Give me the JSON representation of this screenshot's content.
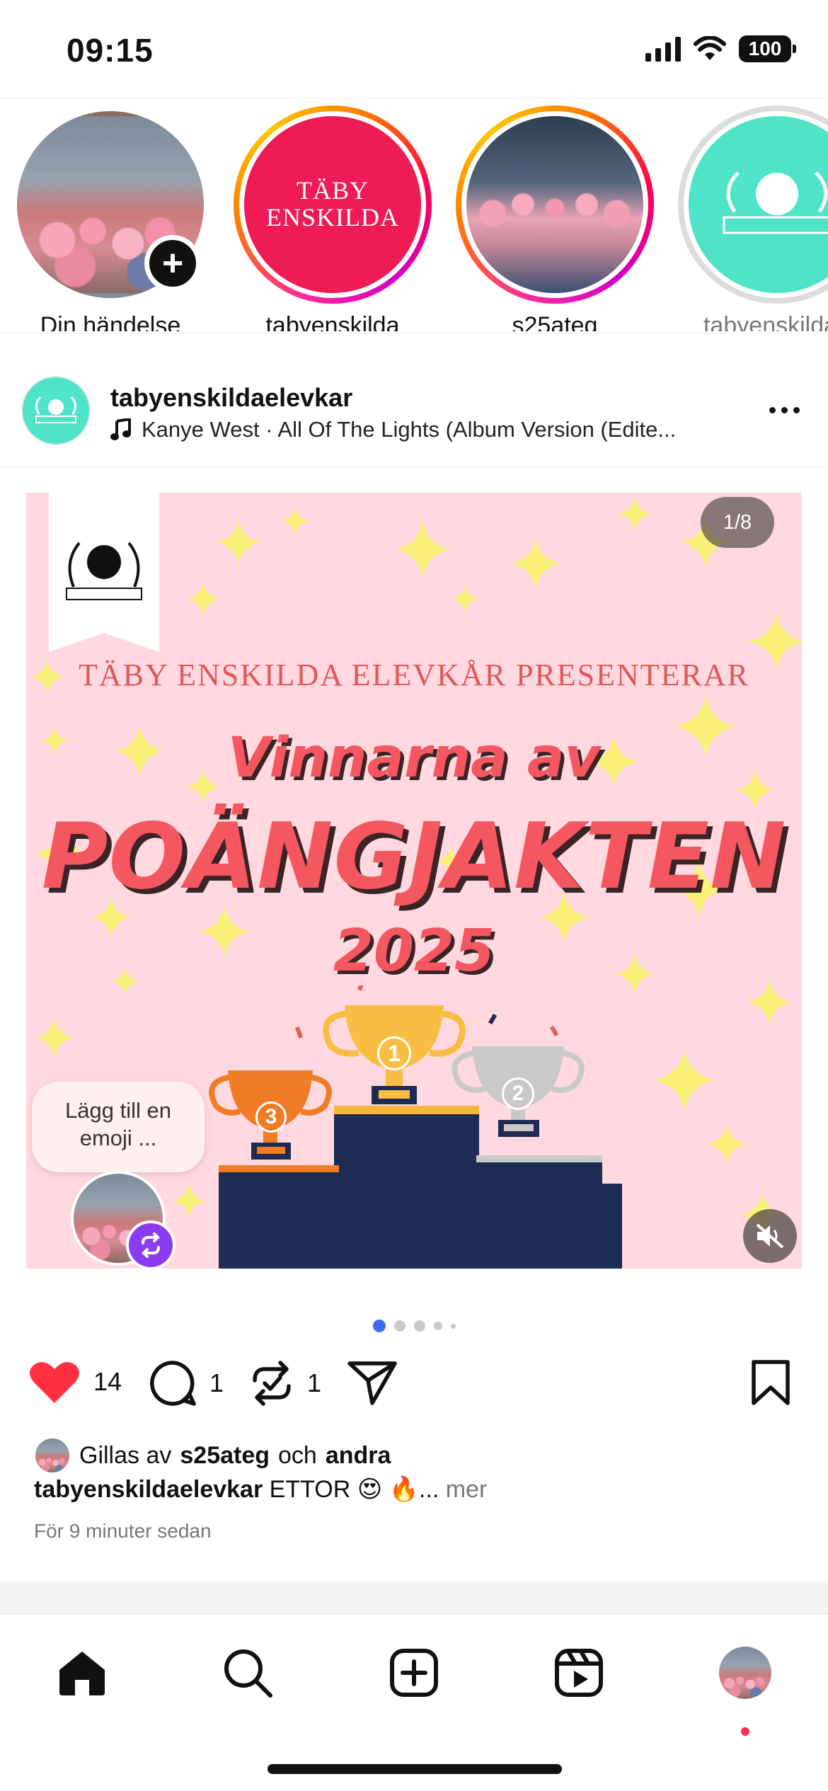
{
  "status_bar": {
    "time": "09:15",
    "battery": "100"
  },
  "stories": [
    {
      "label": "Din händelse",
      "ring": "none",
      "image": "crowd-photo",
      "has_add": true
    },
    {
      "label": "tabyenskilda",
      "ring": "active",
      "image": "logo-pink",
      "logo_text_line1": "TÄBY",
      "logo_text_line2": "ENSKILDA"
    },
    {
      "label": "s25ateg",
      "ring": "active",
      "image": "group-photo"
    },
    {
      "label": "tabyenskildae",
      "ring": "seen",
      "image": "logo-teal"
    }
  ],
  "post": {
    "username": "tabyenskildaelevkar",
    "music": "Kanye West · All Of The Lights (Album Version (Edite...",
    "image": {
      "presenter": "TÄBY ENSKILDA ELEVKÅR PRESENTERAR",
      "headline_small": "Vinnarna av",
      "headline_big": "POÄNGJAKTEN",
      "year": "2025",
      "counter": "1/8",
      "emoji_prompt_line1": "Lägg till en",
      "emoji_prompt_line2": "emoji ...",
      "trophy_labels": [
        "3",
        "1",
        "2"
      ]
    },
    "carousel": {
      "total_visible_dots": 5,
      "active_index": 0
    },
    "likes": "14",
    "comments": "1",
    "reposts": "1",
    "liked_by_prefix": "Gillas av",
    "liked_by_user": "s25ateg",
    "liked_by_join": "och",
    "liked_by_others": "andra",
    "caption_user": "tabyenskildaelevkar",
    "caption_text": "ETTOR 😍 🔥...",
    "caption_more": "mer",
    "timestamp": "För 9 minuter sedan"
  },
  "nav": {
    "items": [
      "home",
      "search",
      "create",
      "reels",
      "profile"
    ]
  },
  "colors": {
    "like_red": "#ff3040",
    "ring_gradient_start": "#ff2d95",
    "repost_purple": "#8b3cf0",
    "poster_pink": "#ffd9df",
    "headline_red": "#f4575f"
  }
}
